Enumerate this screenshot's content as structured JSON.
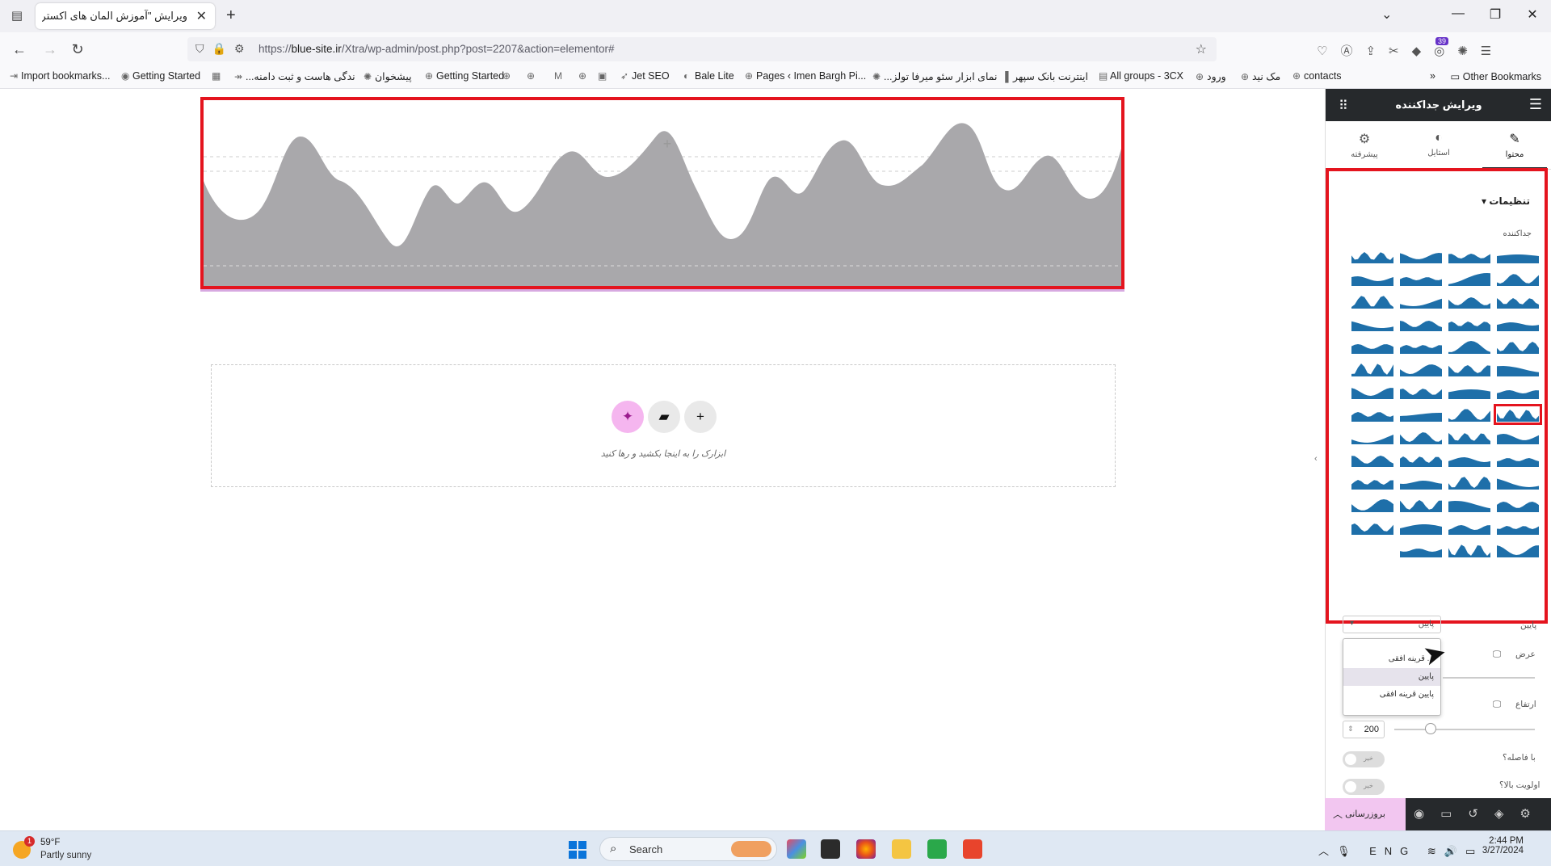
{
  "browser": {
    "tab_title": "ویرایش \"آموزش المان های اکسترا - ...",
    "url_prefix": "https://",
    "url_domain": "blue-site.ir",
    "url_path": "/Xtra/wp-admin/post.php?post=2207&action=elementor#",
    "ext_badge": "39",
    "bookmarks": [
      {
        "icon": "import-icon",
        "label": "Import bookmarks..."
      },
      {
        "icon": "firefox-icon",
        "label": "Getting Started"
      },
      {
        "icon": "calendar-icon",
        "label": ""
      },
      {
        "icon": "link-icon",
        "label": "...ندگی هاست و ثبت دامنه"
      },
      {
        "icon": "swirl-icon",
        "label": "پیشخوان"
      },
      {
        "icon": "globe-icon",
        "label": "Getting Started"
      },
      {
        "icon": "globe-icon",
        "label": ""
      },
      {
        "icon": "globe-icon",
        "label": ""
      },
      {
        "icon": "gmail-icon",
        "label": ""
      },
      {
        "icon": "globe-icon",
        "label": ""
      },
      {
        "icon": "box-icon",
        "label": ""
      },
      {
        "icon": "rocket-icon",
        "label": "Jet SEO"
      },
      {
        "icon": "bale-icon",
        "label": "Bale Lite"
      },
      {
        "icon": "globe-icon",
        "label": "Pages ‹ Imen Bargh Pi..."
      },
      {
        "icon": "swirl-icon",
        "label": "...نمای ابزار سئو میرفا تولز"
      },
      {
        "icon": "bank-icon",
        "label": "اینترنت بانک سپهر"
      },
      {
        "icon": "3cx-icon",
        "label": "All groups - 3CX"
      },
      {
        "icon": "globe-icon",
        "label": "ورود"
      },
      {
        "icon": "globe-icon",
        "label": "مک نید"
      },
      {
        "icon": "globe-icon",
        "label": "contacts"
      }
    ],
    "other_bookmarks": "Other Bookmarks"
  },
  "canvas": {
    "drop_text": "ابزارک را به اینجا بکشید و رها کنید"
  },
  "panel": {
    "title": "ویرایش جداکننده",
    "tabs": [
      {
        "label": "محتوا",
        "icon": "pencil-icon"
      },
      {
        "label": "استایل",
        "icon": "contrast-icon"
      },
      {
        "label": "پیشرفته",
        "icon": "gear-icon"
      }
    ],
    "section_title": "تنظیمات",
    "divider_label": "جداکننده",
    "position_label": "پایین",
    "position_value": "پایین",
    "dropdown_options": [
      "... قرینه افقی",
      "پایین",
      "پایین قرینه افقی"
    ],
    "width_label": "عرض",
    "height_label": "ارتفاع",
    "height_value": "200",
    "spacing_label": "با فاصله؟",
    "spacing_toggle": "خیر",
    "priority_label": "اولویت بالا؟",
    "priority_toggle": "خیر",
    "publish_label": "بروزرسانی"
  },
  "taskbar": {
    "temperature": "59°F",
    "weather": "Partly sunny",
    "weather_badge": "1",
    "search": "Search",
    "lang": "ENG",
    "time": "2:44 PM",
    "date": "3/27/2024"
  },
  "colors": {
    "highlight_red": "#e4141e",
    "divider_gray": "#a9a8ab",
    "thumb_blue": "#1e6fa9",
    "panel_dark": "#26292c"
  }
}
